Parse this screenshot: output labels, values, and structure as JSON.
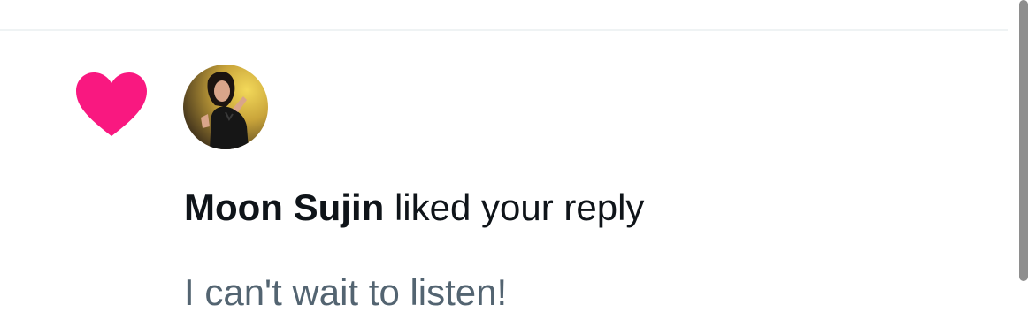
{
  "notification": {
    "type_icon": "heart-icon",
    "user": {
      "name": "Moon Sujin",
      "avatar": "avatar-photo"
    },
    "action_text": "liked your reply",
    "reply_text": "I can't wait to listen!"
  },
  "colors": {
    "heart": "#f91880",
    "primary_text": "#0f1419",
    "secondary_text": "#536471",
    "divider": "#eff3f4",
    "scrollbar": "#8e8e8e"
  }
}
